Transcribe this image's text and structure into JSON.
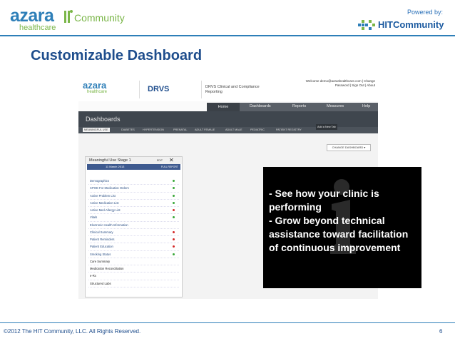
{
  "header": {
    "logo_brand": "azara",
    "logo_sub": "healthcare",
    "logo_community": "Community",
    "powered_by": "Powered by:",
    "hit_brand": "HITCommunity"
  },
  "slide": {
    "title": "Customizable Dashboard"
  },
  "app": {
    "logo_brand": "azara",
    "logo_sub": "healthcare",
    "product": "DRVS",
    "product_sub": "DRVS Clinical and Compliance Reporting",
    "welcome_line1": "Welcome demo@azarahealthcare.com | Change",
    "welcome_line2": "Password | Sign Out | About",
    "nav": [
      "Home",
      "Dashboards",
      "Reports",
      "Measures",
      "Help"
    ],
    "page_title": "Dashboards",
    "tabs": [
      "MEANINGFUL USE",
      "DIABETES",
      "HYPERTENSION",
      "PRENATAL",
      "ADULT FEMALE",
      "ADULT MALE",
      "PEDIATRIC",
      "PATIENT REGISTRY"
    ],
    "add_tab": "Add a New Tab",
    "change_dashboard": "CHANGE DASHBOARD ▾",
    "panel": {
      "title": "Meaningful Use Stage 1",
      "edit": "EDIT",
      "close": "✕",
      "date": "11 March 2013",
      "full_report": "FULL REPORT",
      "rows": [
        {
          "label": "Demographics",
          "status": "green"
        },
        {
          "label": "CPOE For Medication Orders",
          "status": "green"
        },
        {
          "label": "Active Problem List",
          "status": "green"
        },
        {
          "label": "Active Medication List",
          "status": "green"
        },
        {
          "label": "Active Med-Allergy List",
          "status": "red"
        },
        {
          "label": "Vitals",
          "status": "green"
        },
        {
          "label": "Electronic Health Information",
          "status": "none"
        },
        {
          "label": "Clinical Summary",
          "status": "red"
        },
        {
          "label": "Patient Reminders",
          "status": "red"
        },
        {
          "label": "Patient Education",
          "status": "red"
        },
        {
          "label": "Smoking Status",
          "status": "green"
        },
        {
          "label": "Care Summary",
          "status": "none",
          "plain": true
        },
        {
          "label": "Medication Reconciliation",
          "status": "none",
          "plain": true
        },
        {
          "label": "e-Rx",
          "status": "none",
          "plain": true
        },
        {
          "label": "Structured Labs",
          "status": "none",
          "plain": true
        }
      ]
    }
  },
  "callout": {
    "bullet1": "-   See how your clinic is performing",
    "bullet2": "-   Grow beyond technical assistance toward facilitation of continuous improvement"
  },
  "footer": {
    "copyright": "©2012 The HIT Community, LLC. All Rights Reserved.",
    "page": "6"
  },
  "colors": {
    "brand_blue": "#2e7fb8",
    "brand_green": "#7ab648",
    "title_navy": "#1e4d8c",
    "status_green": "#3aa83a",
    "status_red": "#d42a2a"
  },
  "icons": [
    "hit-person-icon",
    "hit-grid-icon",
    "info-mark-icon",
    "close-icon"
  ]
}
